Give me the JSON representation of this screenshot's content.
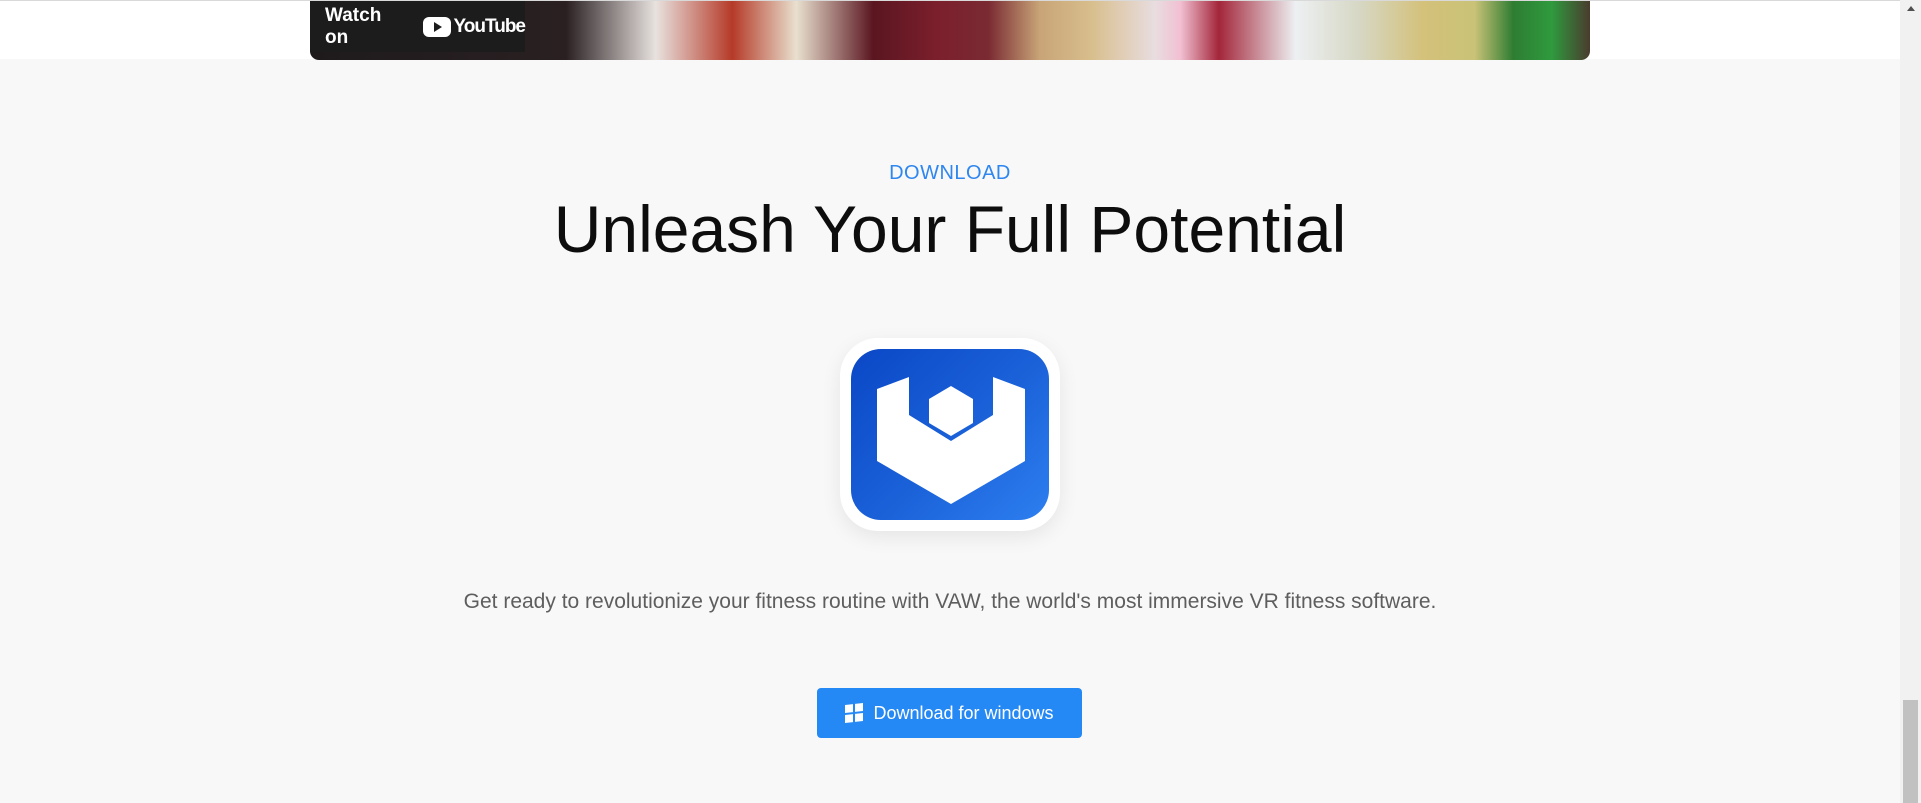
{
  "video": {
    "watch_on_label": "Watch on",
    "youtube_label": "YouTube",
    "youtube_icon": "youtube-play-icon"
  },
  "download_section": {
    "eyebrow": "DOWNLOAD",
    "headline": "Unleash Your Full Potential",
    "app_icon": "vaw-app-logo",
    "description": "Get ready to revolutionize your fitness routine with VAW, the world's most immersive VR fitness software.",
    "button_label": "Download for windows",
    "button_icon": "windows-icon"
  },
  "colors": {
    "accent": "#2589f5",
    "eyebrow": "#2e86f0",
    "logo_blue": "#0a47c6",
    "headline": "#0d0d0d",
    "body_text": "#5e5e5e",
    "background": "#f8f8f8"
  }
}
